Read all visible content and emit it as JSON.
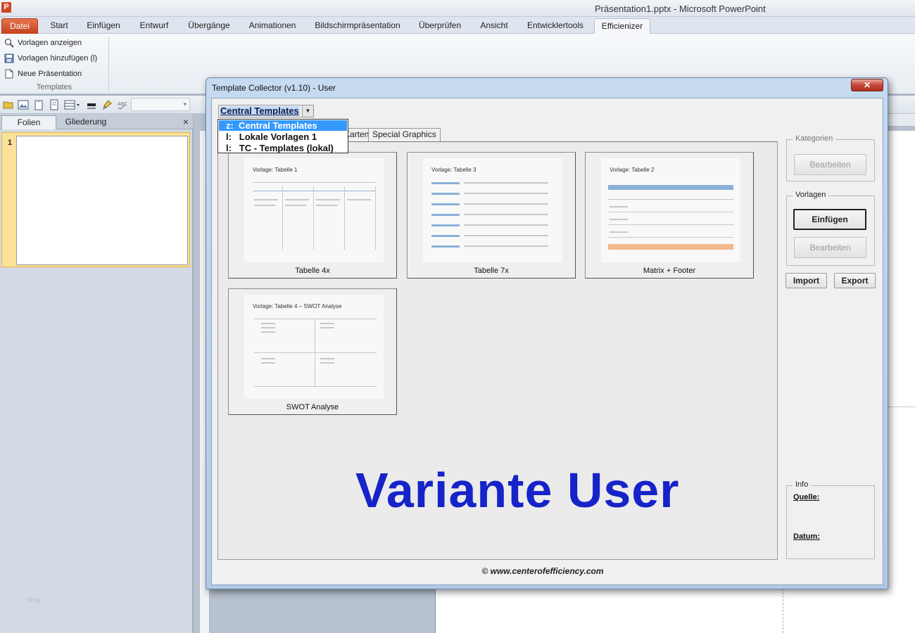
{
  "window": {
    "title": "Präsentation1.pptx - Microsoft PowerPoint",
    "app_icon": "P"
  },
  "ribbon": {
    "tabs": [
      "Datei",
      "Start",
      "Einfügen",
      "Entwurf",
      "Übergänge",
      "Animationen",
      "Bildschirmpräsentation",
      "Überprüfen",
      "Ansicht",
      "Entwicklertools",
      "Efficienizer"
    ],
    "active_tab": "Efficienizer",
    "group": {
      "items": [
        "Vorlagen anzeigen",
        "Vorlagen hinzufügen (l)",
        "Neue Präsentation"
      ],
      "label": "Templates"
    }
  },
  "left_pane": {
    "tabs": [
      "Folien",
      "Gliederung"
    ],
    "close": "×",
    "slide_number": "1",
    "watermark": "blog"
  },
  "dialog": {
    "title": "Template Collector (v1.10) - User",
    "close": "✕",
    "source_combo": {
      "selected": "Central Templates",
      "options": [
        "z:  Central Templates",
        "l:   Lokale Vorlagen 1",
        "l:   TC - Templates (lokal)"
      ],
      "highlighted_index": 0
    },
    "category_tabs": [
      "Karten",
      "Special Graphics"
    ],
    "templates": [
      {
        "caption": "Tabelle 4x",
        "thumb_title": "Vorlage: Tabelle 1"
      },
      {
        "caption": "Tabelle 7x",
        "thumb_title": "Vorlage: Tabelle 3"
      },
      {
        "caption": "Matrix + Footer",
        "thumb_title": "Vorlage: Tabelle 2"
      },
      {
        "caption": "SWOT Analyse",
        "thumb_title": "Vorlage: Tabelle 4 – SWOT Analyse"
      }
    ],
    "overlay_text": "Variante User",
    "copyright": "© www.centerofefficiency.com",
    "right_panel": {
      "kategorien": {
        "legend": "Kategorien",
        "edit": "Bearbeiten"
      },
      "vorlagen": {
        "legend": "Vorlagen",
        "insert": "Einfügen",
        "edit": "Bearbeiten"
      },
      "import": "Import",
      "export": "Export",
      "info": {
        "legend": "Info",
        "source_label": "Quelle:",
        "date_label": "Datum:"
      }
    }
  },
  "colors": {
    "file_tab": "#d24726",
    "overlay_text": "#1523c8",
    "selection": "#3399ff",
    "slide_highlight": "#fbe19a"
  }
}
